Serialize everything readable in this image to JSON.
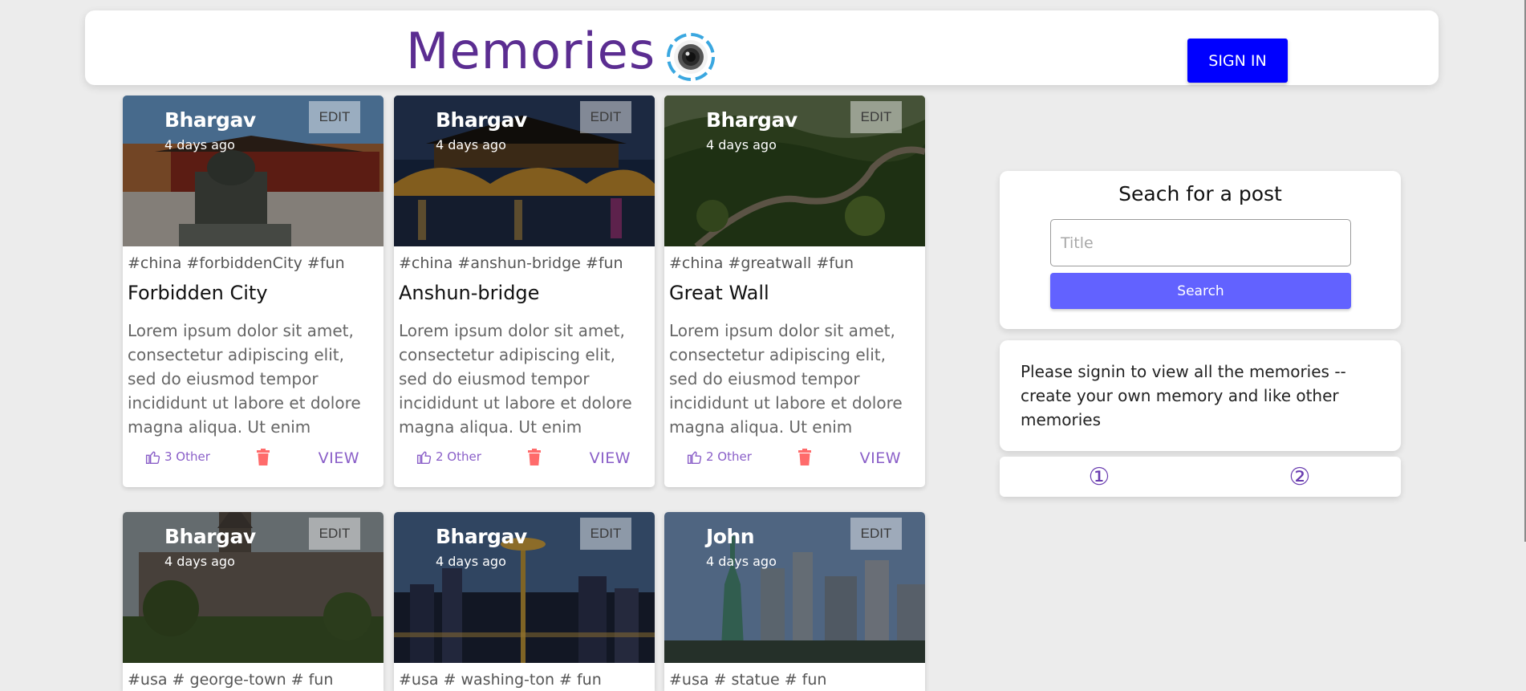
{
  "header": {
    "brand": "Memories",
    "signin_label": "SIGN IN"
  },
  "colors": {
    "brand": "#5b2d91",
    "signin_bg": "#0000ff",
    "search_btn_bg": "#6262ff",
    "accent_purple": "#8a5fc8",
    "delete_red": "#ff6b6b"
  },
  "posts": [
    {
      "author": "Bhargav",
      "time": "4 days ago",
      "edit_label": "EDIT",
      "tags": "#china #forbiddenCity #fun",
      "title": "Forbidden City",
      "body": "Lorem ipsum dolor sit amet, consectetur adipiscing elit, sed do eiusmod tempor incididunt ut labore et dolore magna aliqua. Ut enim",
      "likes": "3 Other",
      "view_label": "VIEW",
      "image": "forbidden-city-photo"
    },
    {
      "author": "Bhargav",
      "time": "4 days ago",
      "edit_label": "EDIT",
      "tags": "#china #anshun-bridge #fun",
      "title": "Anshun-bridge",
      "body": "Lorem ipsum dolor sit amet, consectetur adipiscing elit, sed do eiusmod tempor incididunt ut labore et dolore magna aliqua. Ut enim",
      "likes": "2 Other",
      "view_label": "VIEW",
      "image": "anshun-bridge-photo"
    },
    {
      "author": "Bhargav",
      "time": "4 days ago",
      "edit_label": "EDIT",
      "tags": "#china #greatwall #fun",
      "title": "Great Wall",
      "body": "Lorem ipsum dolor sit amet, consectetur adipiscing elit, sed do eiusmod tempor incididunt ut labore et dolore magna aliqua. Ut enim",
      "likes": "2 Other",
      "view_label": "VIEW",
      "image": "great-wall-photo"
    },
    {
      "author": "Bhargav",
      "time": "4 days ago",
      "edit_label": "EDIT",
      "tags": "#usa # george-town # fun",
      "image": "georgetown-photo"
    },
    {
      "author": "Bhargav",
      "time": "4 days ago",
      "edit_label": "EDIT",
      "tags": "#usa # washing-ton # fun",
      "image": "seattle-skyline-photo"
    },
    {
      "author": "John",
      "time": "4 days ago",
      "edit_label": "EDIT",
      "tags": "#usa # statue # fun",
      "image": "statue-of-liberty-photo"
    }
  ],
  "search": {
    "title": "Seach for a post",
    "placeholder": "Title",
    "button_label": "Search"
  },
  "notice": "Please signin to view all the memories -- create your own memory and like other memories",
  "pagination": {
    "pages": [
      "①",
      "②"
    ]
  }
}
